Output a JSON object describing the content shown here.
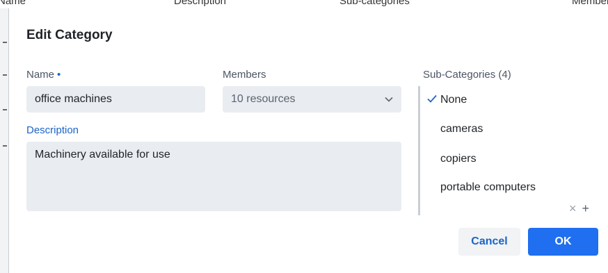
{
  "background_table": {
    "headers": [
      "Name",
      "Description",
      "Sub-categories",
      "Member"
    ]
  },
  "dialog": {
    "title": "Edit Category",
    "name_label": "Name",
    "name_required_mark": "•",
    "name_value": "office machines",
    "members_label": "Members",
    "members_value": "10 resources",
    "description_label": "Description",
    "description_value": "Machinery available for use",
    "subcategories_label": "Sub-Categories (4)",
    "subcategories": [
      {
        "label": "None",
        "selected": true
      },
      {
        "label": "cameras",
        "selected": false
      },
      {
        "label": "copiers",
        "selected": false
      },
      {
        "label": "portable computers",
        "selected": false
      }
    ],
    "clear_icon": "×",
    "add_icon": "+",
    "cancel_label": "Cancel",
    "ok_label": "OK"
  },
  "colors": {
    "accent": "#1f6ff0",
    "link": "#1b64c8",
    "field_bg": "#e9ecf0"
  }
}
